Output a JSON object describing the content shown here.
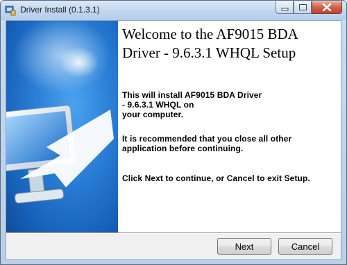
{
  "window": {
    "title": "Driver Install (0.1.3.1)"
  },
  "welcome": {
    "heading": "Welcome to the AF9015 BDA Driver - 9.6.3.1 WHQL Setup",
    "install_line1": "This will install AF9015 BDA Driver",
    "install_line2": "- 9.6.3.1 WHQL on",
    "install_line3": "your computer.",
    "recommend_line1": "It is recommended that you close all other",
    "recommend_line2": "application before continuing.",
    "instruction": "Click Next to continue, or Cancel to exit Setup."
  },
  "buttons": {
    "next": "Next",
    "cancel": "Cancel"
  },
  "icons": {
    "app": "installer-icon",
    "banner": "monitor-arrow-illustration",
    "minimize": "minimize-icon",
    "maximize": "maximize-icon",
    "close": "close-icon"
  },
  "colors": {
    "banner_blue": "#1f6fc6",
    "close_red": "#c0432b"
  }
}
